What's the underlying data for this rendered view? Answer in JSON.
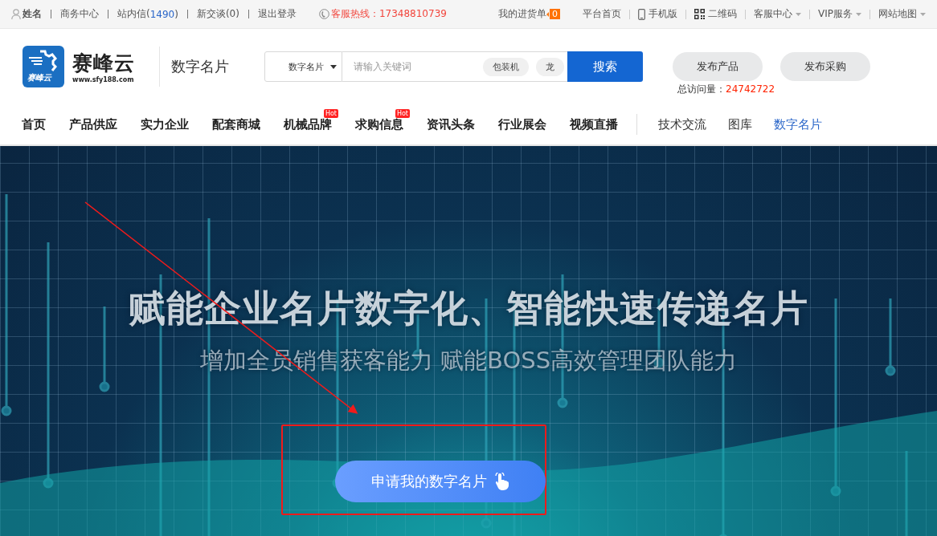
{
  "topbar": {
    "user": "姓名",
    "links": [
      {
        "prefix": "商务中心"
      },
      {
        "prefix": "站内信(",
        "count": "1490",
        "suffix": ")"
      },
      {
        "prefix": "新交谈(0)"
      },
      {
        "prefix": "退出登录"
      }
    ],
    "hotline": "客服热线：17348810739",
    "cart": {
      "label": "我的进货单",
      "badge": "0"
    },
    "right_links": [
      {
        "kind": "plain",
        "label": "平台首页",
        "dropdown": false
      },
      {
        "kind": "phone",
        "label": "手机版",
        "dropdown": false
      },
      {
        "kind": "qr",
        "label": "二维码",
        "dropdown": false
      },
      {
        "kind": "plain",
        "label": "客服中心",
        "dropdown": true
      },
      {
        "kind": "plain",
        "label": "VIP服务",
        "dropdown": true
      },
      {
        "kind": "plain",
        "label": "网站地图",
        "dropdown": true
      }
    ]
  },
  "header": {
    "logo": {
      "badge_text": "赛峰云",
      "name": "赛峰云",
      "url": "www.sfy188.com"
    },
    "section_title": "数字名片",
    "search": {
      "category": "数字名片",
      "placeholder": "请输入关键词",
      "tags": [
        "包装机",
        "龙"
      ],
      "button": "搜索"
    },
    "buttons": [
      "发布产品",
      "发布采购"
    ],
    "visits": {
      "label": "总访问量：",
      "value": "24742722"
    }
  },
  "nav": [
    {
      "label": "首页",
      "kind": "primary",
      "selected": false
    },
    {
      "label": "产品供应",
      "kind": "primary",
      "selected": false
    },
    {
      "label": "实力企业",
      "kind": "primary",
      "selected": false
    },
    {
      "label": "配套商城",
      "kind": "primary",
      "selected": false
    },
    {
      "label": "机械品牌",
      "kind": "primary",
      "badge": "Hot",
      "selected": false
    },
    {
      "label": "求购信息",
      "kind": "primary",
      "badge": "Hot",
      "selected": false
    },
    {
      "label": "资讯头条",
      "kind": "primary",
      "selected": false
    },
    {
      "label": "行业展会",
      "kind": "primary",
      "selected": false
    },
    {
      "label": "视频直播",
      "kind": "primary",
      "selected": false
    },
    {
      "label": "技术交流",
      "kind": "secondary",
      "selected": false
    },
    {
      "label": "图库",
      "kind": "secondary",
      "selected": false
    },
    {
      "label": "数字名片",
      "kind": "secondary",
      "selected": true
    }
  ],
  "hero": {
    "title": "赋能企业名片数字化、智能快速传递名片",
    "subtitle": "增加全员销售获客能力 赋能BOSS高效管理团队能力",
    "cta": "申请我的数字名片"
  }
}
